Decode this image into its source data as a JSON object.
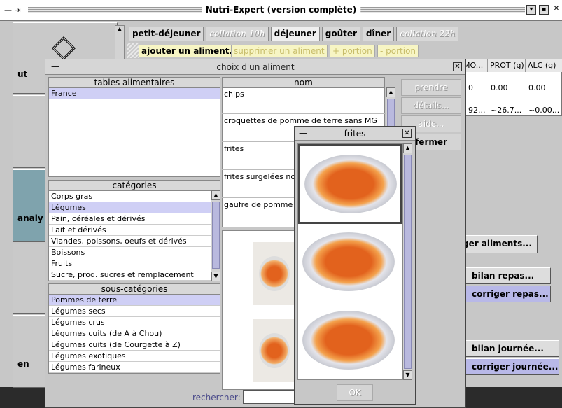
{
  "main_window": {
    "title": "Nutri-Expert (version complète)",
    "side": [
      "ut",
      "analy",
      "en"
    ],
    "tabs": [
      {
        "label": "petit-déjeuner",
        "state": "normal"
      },
      {
        "label": "collation 10h",
        "state": "disabled"
      },
      {
        "label": "déjeuner",
        "state": "selected"
      },
      {
        "label": "goûter",
        "state": "normal"
      },
      {
        "label": "dîner",
        "state": "normal"
      },
      {
        "label": "collation 22h",
        "state": "disabled"
      }
    ],
    "actions": {
      "add": "ajouter un aliment...",
      "remove": "supprimer un aliment",
      "plus": "+ portion",
      "minus": "- portion"
    },
    "table": {
      "headers": [
        "MO...",
        "PROT (g)",
        "ALC (g)"
      ],
      "rows": [
        [
          "0",
          "0.00",
          "0.00"
        ],
        [
          "92...",
          "~26.7...",
          "~0.00..."
        ]
      ]
    },
    "buttons": {
      "charger": "ger aliments...",
      "bilan_repas": "bilan repas...",
      "corriger_repas": "corriger repas...",
      "bilan_journee": "bilan journée...",
      "corriger_journee": "corriger journée..."
    }
  },
  "dialog": {
    "title": "choix d'un aliment",
    "tables_header": "tables alimentaires",
    "tables": [
      "France"
    ],
    "categories_header": "catégories",
    "categories": [
      "Corps gras",
      "Légumes",
      "Pain, céréales et dérivés",
      "Lait et dérivés",
      "Viandes, poissons, oeufs et dérivés",
      "Boissons",
      "Fruits",
      "Sucre, prod. sucres et remplacement"
    ],
    "categories_selected": 1,
    "subcategories_header": "sous-catégories",
    "subcategories": [
      "Pommes de terre",
      "Légumes secs",
      "Légumes crus",
      "Légumes cuits (de A à Chou)",
      "Légumes cuits (de Courgette à Z)",
      "Légumes exotiques",
      "Légumes farineux"
    ],
    "subcategories_selected": 0,
    "nom_header": "nom",
    "noms": [
      "chips",
      "croquettes de pomme de terre sans MG",
      "frites",
      "frites surgelées no",
      "gaufre de pomme"
    ],
    "buttons": {
      "prendre": "prendre",
      "details": "détails...",
      "aide": "aide...",
      "fermer": "fermer"
    },
    "search_label": "rechercher:",
    "search_value": ""
  },
  "popup": {
    "title": "frites",
    "ok": "OK"
  }
}
